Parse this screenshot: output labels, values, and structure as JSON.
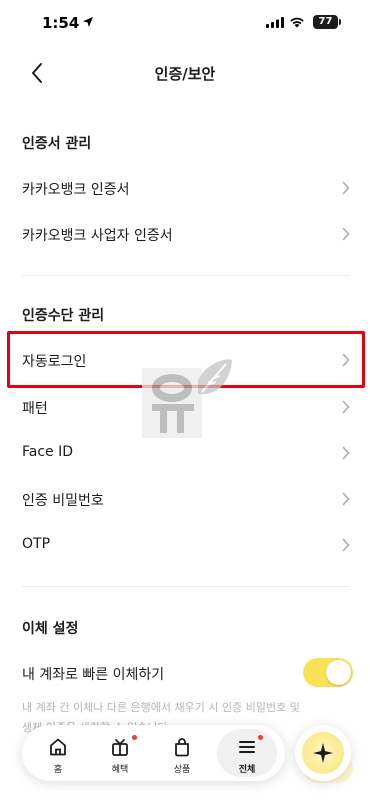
{
  "status": {
    "time": "1:54",
    "battery": "77"
  },
  "header": {
    "title": "인증/보안"
  },
  "sections": {
    "cert": {
      "title": "인증서 관리",
      "items": [
        {
          "label": "카카오뱅크 인증서"
        },
        {
          "label": "카카오뱅크 사업자 인증서"
        }
      ]
    },
    "method": {
      "title": "인증수단 관리",
      "items": [
        {
          "label": "자동로그인"
        },
        {
          "label": "패턴"
        },
        {
          "label": "Face ID"
        },
        {
          "label": "인증 비밀번호"
        },
        {
          "label": "OTP"
        }
      ]
    },
    "transfer": {
      "title": "이체 설정",
      "toggle_label": "내 계좌로 빠른 이체하기",
      "toggle_on": true,
      "description": "내 계좌 간 이체나 다른 은행에서 채우기 시 인증 비밀번호 및 생체 인증을 생략할 수 있습니다"
    }
  },
  "tabbar": {
    "tabs": [
      {
        "label": "홈",
        "icon": "home-icon",
        "badge": false
      },
      {
        "label": "혜택",
        "icon": "gift-icon",
        "badge": true
      },
      {
        "label": "상품",
        "icon": "bag-icon",
        "badge": false
      },
      {
        "label": "전체",
        "icon": "menu-icon",
        "badge": true,
        "active": true
      }
    ]
  },
  "fab": {
    "icon": "sparkle-icon"
  },
  "colors": {
    "accent": "#f8e356",
    "highlight": "#e8000f",
    "badge": "#ee3b2e"
  }
}
